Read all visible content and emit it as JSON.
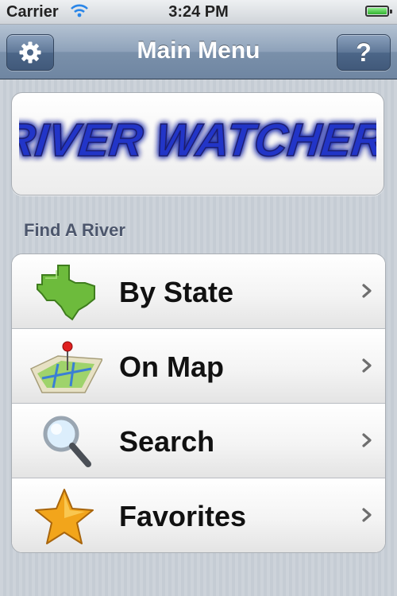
{
  "status_bar": {
    "carrier": "Carrier",
    "time": "3:24 PM",
    "battery_level": 1.0
  },
  "nav_bar": {
    "title": "Main Menu",
    "settings_icon": "gear-icon",
    "help_label": "?"
  },
  "logo": {
    "text": "RIVER WATCHER",
    "colors": {
      "fill": "#2236c8",
      "glow": "#7f8bff"
    }
  },
  "section": {
    "header": "Find A River"
  },
  "menu": {
    "items": [
      {
        "label": "By State",
        "icon": "texas-state-icon"
      },
      {
        "label": "On Map",
        "icon": "map-pin-icon"
      },
      {
        "label": "Search",
        "icon": "magnifier-icon"
      },
      {
        "label": "Favorites",
        "icon": "star-icon"
      }
    ]
  },
  "colors": {
    "nav_bar": "#7a90aa",
    "background": "#c5ccd4",
    "section_header": "#4c566c"
  }
}
